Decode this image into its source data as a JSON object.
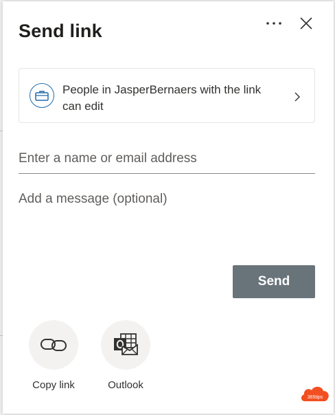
{
  "dialog": {
    "title": "Send link",
    "more_icon": "more-horizontal-icon",
    "close_icon": "close-icon"
  },
  "permission": {
    "icon": "briefcase-icon",
    "text": "People in JasperBernaers with the link can edit",
    "chevron_icon": "chevron-right-icon"
  },
  "recipients": {
    "placeholder": "Enter a name or email address"
  },
  "message": {
    "placeholder": "Add a message (optional)"
  },
  "send_button": {
    "label": "Send"
  },
  "share_options": [
    {
      "label": "Copy link",
      "icon": "link-icon"
    },
    {
      "label": "Outlook",
      "icon": "outlook-icon"
    }
  ],
  "badge": {
    "icon": "365tips-cloud-logo",
    "text": "365tips",
    "color": "#f25022"
  },
  "colors": {
    "send_button_bg": "#69737a",
    "permission_icon": "#1f6aab"
  }
}
